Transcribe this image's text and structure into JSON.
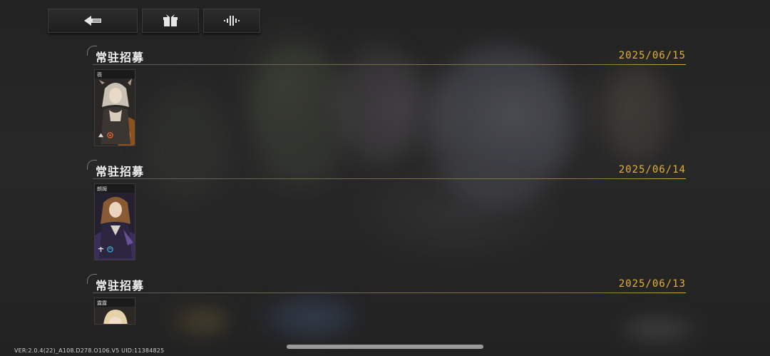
{
  "toolbar": {
    "back_icon": "back-arrow-icon",
    "gift_icon": "gift-box-icon",
    "sound_icon": "sound-wave-icon"
  },
  "records": [
    {
      "title": "常驻招募",
      "date": "2025/06/15",
      "card": {
        "name": "薇",
        "palette": "gray-fire"
      }
    },
    {
      "title": "常驻招募",
      "date": "2025/06/14",
      "card": {
        "name": "朗姆",
        "palette": "brown-violet"
      }
    },
    {
      "title": "常驻招募",
      "date": "2025/06/13",
      "card": {
        "name": "露露",
        "palette": "blonde"
      }
    }
  ],
  "footer": {
    "version": "VER:2.0.4(22)_A108.D278.O106.V5   UID:11384825"
  },
  "colors": {
    "date": "#e2b33a",
    "divider_end": "#d4a93a"
  }
}
